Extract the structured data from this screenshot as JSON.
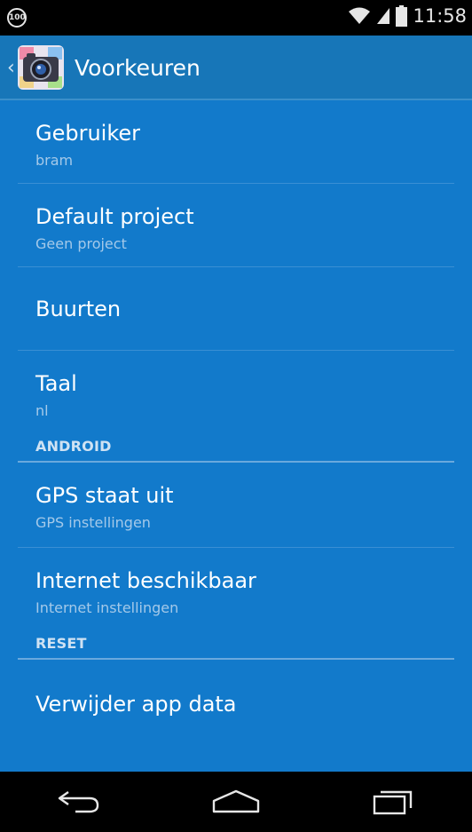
{
  "status_bar": {
    "battery_level": "100",
    "time": "11:58"
  },
  "action_bar": {
    "title": "Voorkeuren",
    "up_icon": "chevron-left-icon",
    "app_icon": "camera-app-icon"
  },
  "preferences": {
    "gebruiker": {
      "title": "Gebruiker",
      "summary": "bram"
    },
    "default_project": {
      "title": "Default project",
      "summary": "Geen project"
    },
    "buurten": {
      "title": "Buurten"
    },
    "taal": {
      "title": "Taal",
      "summary": "nl"
    },
    "category_android": "ANDROID",
    "gps": {
      "title": "GPS staat uit",
      "summary": "GPS instellingen"
    },
    "internet": {
      "title": "Internet beschikbaar",
      "summary": "Internet instellingen"
    },
    "category_reset": "RESET",
    "verwijder": {
      "title": "Verwijder app data"
    }
  },
  "nav_bar": {
    "back_icon": "back-icon",
    "home_icon": "home-icon",
    "recents_icon": "recents-icon"
  },
  "colors": {
    "action_bar_bg": "#1776b8",
    "list_bg": "#127acb",
    "summary_text": "#a4c9e9"
  }
}
